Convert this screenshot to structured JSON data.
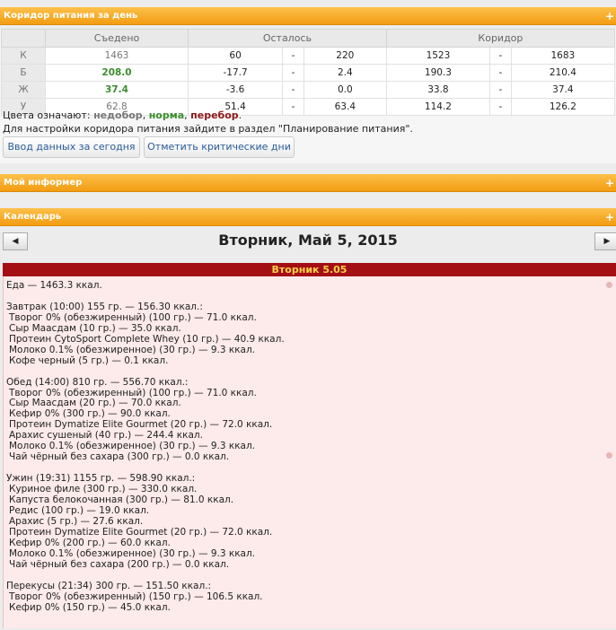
{
  "corridor": {
    "title": "Коридор питания за день",
    "headers": [
      "Съедено",
      "Осталось",
      "Коридор"
    ],
    "rows": [
      {
        "label": "К",
        "eaten": "1463",
        "rem_from": "60",
        "rem_to": "220",
        "cor_from": "1523",
        "cor_to": "1683",
        "status": "under"
      },
      {
        "label": "Б",
        "eaten": "208.0",
        "rem_from": "-17.7",
        "rem_to": "2.4",
        "cor_from": "190.3",
        "cor_to": "210.4",
        "status": "norm"
      },
      {
        "label": "Ж",
        "eaten": "37.4",
        "rem_from": "-3.6",
        "rem_to": "0.0",
        "cor_from": "33.8",
        "cor_to": "37.4",
        "status": "norm"
      },
      {
        "label": "У",
        "eaten": "62.8",
        "rem_from": "51.4",
        "rem_to": "63.4",
        "cor_from": "114.2",
        "cor_to": "126.2",
        "status": "under"
      }
    ],
    "dash": "-",
    "legend_prefix": "Цвета означают:",
    "legend_under": "недобор",
    "legend_norm": "норма",
    "legend_over": "перебор",
    "hint": "Для настройки коридора питания зайдите в раздел \"Планирование питания\".",
    "btn_today": "Ввод данных за сегодня",
    "btn_critical": "Отметить критические дни"
  },
  "informer": {
    "title": "Мой информер"
  },
  "calendar": {
    "title": "Календарь",
    "date": "Вторник, Май 5, 2015",
    "prev": "◀",
    "next": "▶",
    "day_header": "Вторник 5.05",
    "lines": [
      {
        "t": "Еда — 1463.3 ккал.",
        "k": "meal"
      },
      {
        "t": "",
        "k": "blank"
      },
      {
        "t": "Завтрак (10:00) 155 гр. — 156.30 ккал.:",
        "k": "meal"
      },
      {
        "t": "Творог 0% (обезжиренный) (100 гр.) — 71.0 ккал.",
        "k": "item"
      },
      {
        "t": "Сыр Маасдам (10 гр.) — 35.0 ккал.",
        "k": "item"
      },
      {
        "t": "Протеин CytoSport Complete Whey (10 гр.) — 40.9 ккал.",
        "k": "item"
      },
      {
        "t": "Молоко 0.1% (обезжиренное) (30 гр.) — 9.3 ккал.",
        "k": "item"
      },
      {
        "t": "Кофе черный (5 гр.) — 0.1 ккал.",
        "k": "item"
      },
      {
        "t": "",
        "k": "blank"
      },
      {
        "t": "Обед (14:00) 810 гр. — 556.70 ккал.:",
        "k": "meal"
      },
      {
        "t": "Творог 0% (обезжиренный) (100 гр.) — 71.0 ккал.",
        "k": "item"
      },
      {
        "t": "Сыр Маасдам (20 гр.) — 70.0 ккал.",
        "k": "item"
      },
      {
        "t": "Кефир 0% (300 гр.) — 90.0 ккал.",
        "k": "item"
      },
      {
        "t": "Протеин Dymatize Elite Gourmet (20 гр.) — 72.0 ккал.",
        "k": "item"
      },
      {
        "t": "Арахис сушеный (40 гр.) — 244.4 ккал.",
        "k": "item"
      },
      {
        "t": "Молоко 0.1% (обезжиренное) (30 гр.) — 9.3 ккал.",
        "k": "item"
      },
      {
        "t": "Чай чёрный без сахара (300 гр.) — 0.0 ккал.",
        "k": "item"
      },
      {
        "t": "",
        "k": "blank"
      },
      {
        "t": "Ужин (19:31) 1155 гр. — 598.90 ккал.:",
        "k": "meal"
      },
      {
        "t": "Куриное филе (300 гр.) — 330.0 ккал.",
        "k": "item"
      },
      {
        "t": "Капуста белокочанная (300 гр.) — 81.0 ккал.",
        "k": "item"
      },
      {
        "t": "Редис (100 гр.) — 19.0 ккал.",
        "k": "item"
      },
      {
        "t": "Арахис (5 гр.) — 27.6 ккал.",
        "k": "item"
      },
      {
        "t": "Протеин Dymatize Elite Gourmet (20 гр.) — 72.0 ккал.",
        "k": "item"
      },
      {
        "t": "Кефир 0% (200 гр.) — 60.0 ккал.",
        "k": "item"
      },
      {
        "t": "Молоко 0.1% (обезжиренное) (30 гр.) — 9.3 ккал.",
        "k": "item"
      },
      {
        "t": "Чай чёрный без сахара (200 гр.) — 0.0 ккал.",
        "k": "item"
      },
      {
        "t": "",
        "k": "blank"
      },
      {
        "t": "Перекусы (21:34) 300 гр. — 151.50 ккал.:",
        "k": "meal"
      },
      {
        "t": "Творог 0% (обезжиренный) (150 гр.) — 106.5 ккал.",
        "k": "item"
      },
      {
        "t": "Кефир 0% (150 гр.) — 45.0 ккал.",
        "k": "item"
      }
    ]
  },
  "plus": "+"
}
